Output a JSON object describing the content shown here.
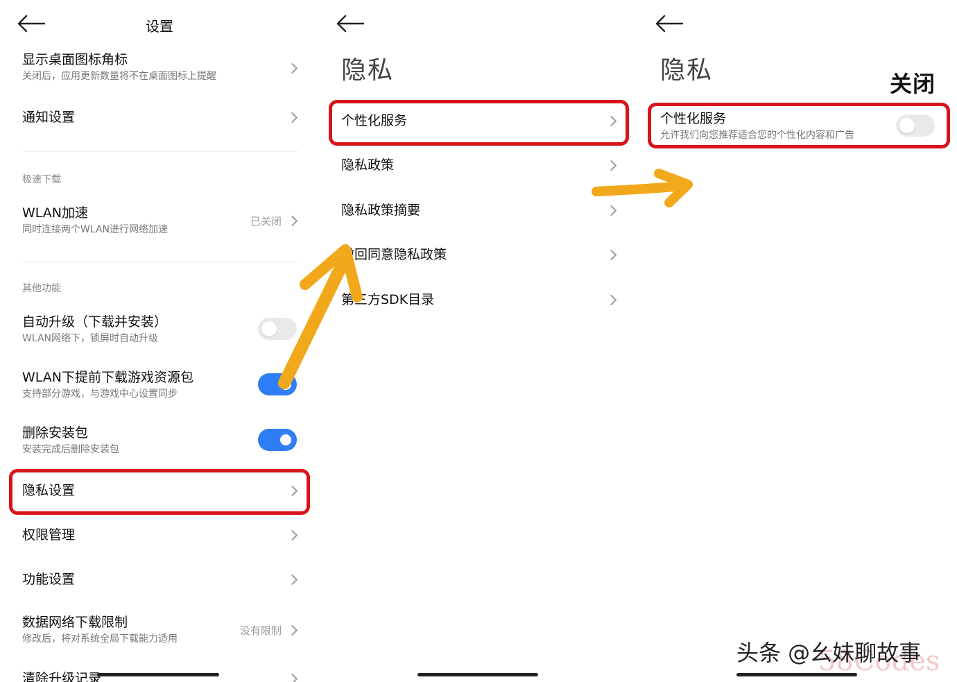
{
  "panel1": {
    "title": "设置",
    "rows": [
      {
        "title": "显示桌面图标角标",
        "subtitle": "关闭后，应用更新数量将不在桌面图标上提醒"
      },
      {
        "title": "通知设置"
      },
      {
        "title": "WLAN加速",
        "subtitle": "同时连接两个WLAN进行网络加速",
        "state": "已关闭"
      },
      {
        "title": "自动升级（下载并安装）",
        "subtitle": "WLAN网络下，锁屏时自动升级",
        "toggle": "off"
      },
      {
        "title": "WLAN下提前下载游戏资源包",
        "subtitle": "支持部分游戏，与游戏中心设置同步",
        "toggle": "on"
      },
      {
        "title": "删除安装包",
        "subtitle": "安装完成后删除安装包",
        "toggle": "on"
      },
      {
        "title": "隐私设置"
      },
      {
        "title": "权限管理"
      },
      {
        "title": "功能设置"
      },
      {
        "title": "数据网络下载限制",
        "subtitle": "修改后，将对系统全局下载能力适用",
        "state": "没有限制"
      },
      {
        "title": "清除升级记录"
      }
    ],
    "sections": [
      "极速下载",
      "其他功能"
    ]
  },
  "panel2": {
    "title": "隐私",
    "rows": [
      {
        "title": "个性化服务"
      },
      {
        "title": "隐私政策"
      },
      {
        "title": "隐私政策摘要"
      },
      {
        "title": "撤回同意隐私政策"
      },
      {
        "title": "第三方SDK目录"
      }
    ]
  },
  "panel3": {
    "title": "隐私",
    "row": {
      "title": "个性化服务",
      "subtitle": "允许我们向您推荐适合您的个性化内容和广告",
      "toggle": "off"
    }
  },
  "annotations": {
    "close_label": "关闭",
    "watermark": "头条 @幺妹聊故事",
    "watermark_site": "58Codes",
    "highlight_color": "#d7141c",
    "arrow_color": "#f1a91b"
  },
  "colors": {
    "toggle_on": "#2f7df6",
    "toggle_off": "#e9e9e9"
  }
}
